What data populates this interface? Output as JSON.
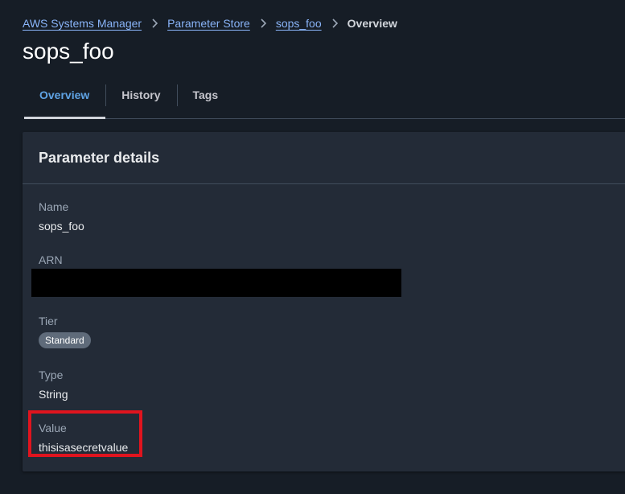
{
  "breadcrumb": {
    "items": [
      {
        "label": "AWS Systems Manager",
        "link": true
      },
      {
        "label": "Parameter Store",
        "link": true
      },
      {
        "label": "sops_foo",
        "link": true
      },
      {
        "label": "Overview",
        "link": false
      }
    ]
  },
  "page": {
    "title": "sops_foo"
  },
  "tabs": [
    {
      "label": "Overview",
      "active": true
    },
    {
      "label": "History",
      "active": false
    },
    {
      "label": "Tags",
      "active": false
    }
  ],
  "details": {
    "title": "Parameter details",
    "name_label": "Name",
    "name_value": "sops_foo",
    "arn_label": "ARN",
    "tier_label": "Tier",
    "tier_value": "Standard",
    "type_label": "Type",
    "type_value": "String",
    "value_label": "Value",
    "value_value": "thisisasecretvalue"
  },
  "colors": {
    "background": "#161d26",
    "panel": "#232b37",
    "link": "#89b4f8",
    "active_tab": "#5fa3e4",
    "highlight": "#e0141e"
  }
}
